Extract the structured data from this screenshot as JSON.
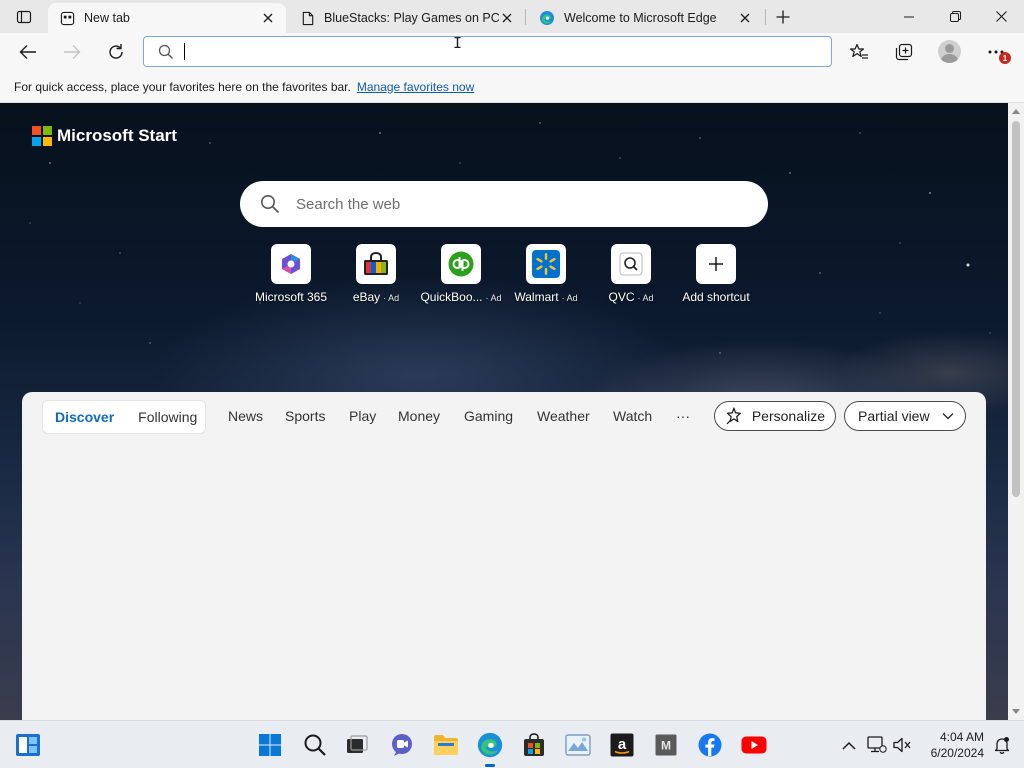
{
  "browser": {
    "tabs": [
      {
        "title": "New tab",
        "active": true,
        "icon": "newtab-page-icon"
      },
      {
        "title": "BlueStacks: Play Games on PC &",
        "active": false,
        "icon": "page-icon"
      },
      {
        "title": "Welcome to Microsoft Edge",
        "active": false,
        "icon": "edge-icon"
      }
    ],
    "address": {
      "value": "",
      "placeholder": ""
    },
    "favorites_bar": {
      "message": "For quick access, place your favorites here on the favorites bar.",
      "link": "Manage favorites now"
    },
    "notification_count": "1"
  },
  "page": {
    "brand": "Microsoft Start",
    "search_placeholder": "Search the web",
    "shortcuts": [
      {
        "label": "Microsoft 365",
        "ad": "",
        "icon": "microsoft365-icon"
      },
      {
        "label": "eBay",
        "ad": "· Ad",
        "icon": "ebay-icon"
      },
      {
        "label": "QuickBoo...",
        "ad": "· Ad",
        "icon": "quickbooks-icon"
      },
      {
        "label": "Walmart",
        "ad": "· Ad",
        "icon": "walmart-icon"
      },
      {
        "label": "QVC",
        "ad": "· Ad",
        "icon": "qvc-icon"
      },
      {
        "label": "Add shortcut",
        "ad": "",
        "icon": "plus-icon"
      }
    ],
    "feed_nav": {
      "discover": "Discover",
      "following": "Following",
      "links": [
        "News",
        "Sports",
        "Play",
        "Money",
        "Gaming",
        "Weather",
        "Watch"
      ],
      "more": "···",
      "personalize": "Personalize",
      "view": "Partial view"
    }
  },
  "taskbar": {
    "time": "4:04 AM",
    "date": "6/20/2024",
    "apps": [
      "start-icon",
      "search-icon",
      "task-view-icon",
      "chat-icon",
      "file-explorer-icon",
      "edge-icon",
      "store-icon",
      "photos-icon",
      "amazon-icon",
      "m-app-icon",
      "facebook-icon",
      "youtube-icon"
    ]
  },
  "colors": {
    "accent": "#0f6cbd",
    "link": "#0f5ba7",
    "notification": "#c42b1c",
    "taskbar": "#e9edf2"
  }
}
